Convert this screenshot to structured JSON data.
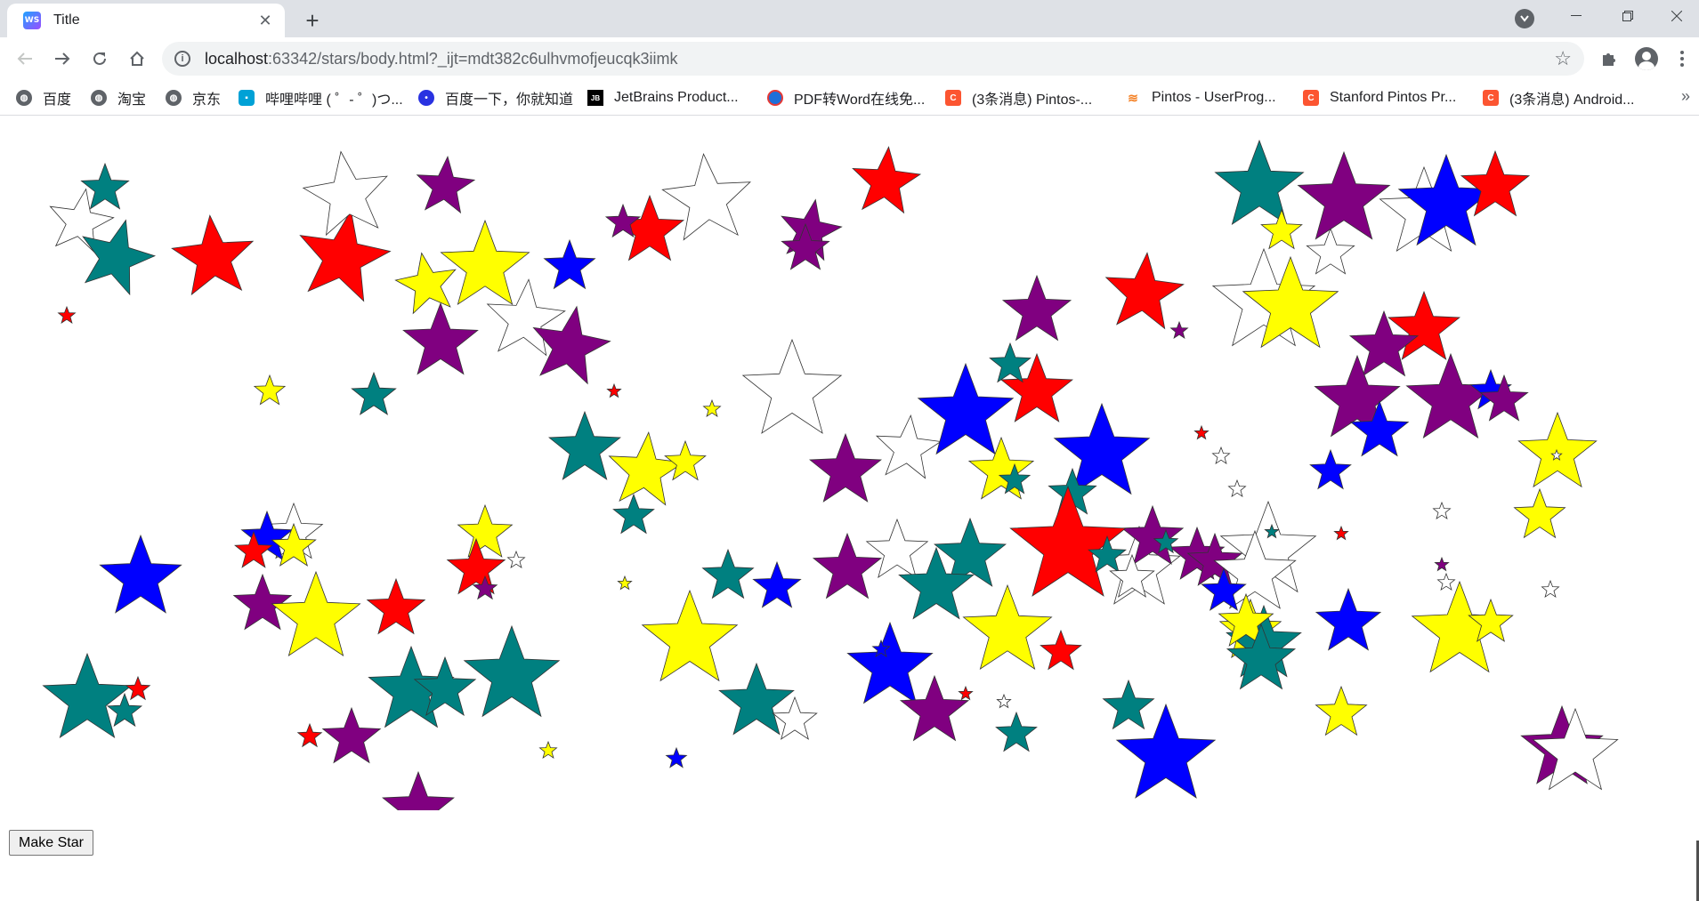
{
  "browser": {
    "tab_title": "Title",
    "favicon_text": "WS",
    "url_host": "localhost",
    "url_rest": ":63342/stars/body.html?_ijt=mdt382c6ulhvmofjeucqk3iimk"
  },
  "bookmarks": [
    {
      "label": "百度",
      "icon": "globe-icon",
      "color": "#5f6368"
    },
    {
      "label": "淘宝",
      "icon": "globe-icon",
      "color": "#5f6368"
    },
    {
      "label": "京东",
      "icon": "globe-icon",
      "color": "#5f6368"
    },
    {
      "label": "哔哩哔哩 ( ゜- ゜)つ...",
      "icon": "bilibili-icon",
      "color": "#00a1d6"
    },
    {
      "label": "百度一下，你就知道",
      "icon": "baidu-paw-icon",
      "color": "#2932e1"
    },
    {
      "label": "JetBrains Product...",
      "icon": "jetbrains-icon",
      "color": "#000000"
    },
    {
      "label": "PDF转Word在线免...",
      "icon": "pdf-icon",
      "color": "#1e6fd9"
    },
    {
      "label": "(3条消息) Pintos-...",
      "icon": "csdn-icon",
      "color": "#fc5531"
    },
    {
      "label": "Pintos - UserProg...",
      "icon": "stackoverflow-icon",
      "color": "#f48024"
    },
    {
      "label": "Stanford Pintos Pr...",
      "icon": "csdn-icon",
      "color": "#fc5531"
    },
    {
      "label": "(3条消息) Android...",
      "icon": "csdn-icon",
      "color": "#fc5531"
    }
  ],
  "page": {
    "button_label": "Make Star"
  },
  "star_colors": [
    "#ff0000",
    "#0000ff",
    "#ffff00",
    "#008080",
    "#800080",
    "#ffffff"
  ]
}
